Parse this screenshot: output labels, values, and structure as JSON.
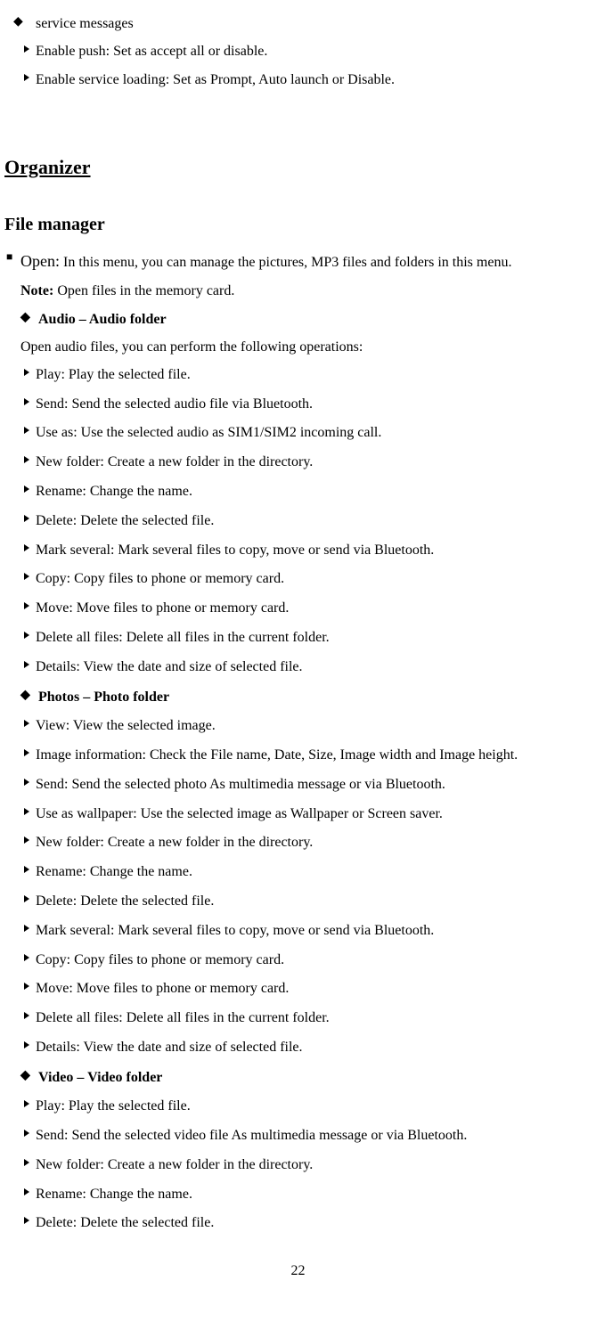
{
  "top": {
    "service_messages": "service messages",
    "enable_push": "Enable push: Set as accept all or disable.",
    "enable_service_loading": "Enable service loading: Set as Prompt, Auto launch or Disable."
  },
  "organizer_title": "Organizer",
  "file_manager_title": "File manager",
  "open": {
    "label": "Open:",
    "desc": " In this menu, you can manage the pictures, MP3 files and folders in this menu."
  },
  "note": {
    "label": "Note:",
    "desc": " Open files in the memory card."
  },
  "audio": {
    "title": "Audio – Audio folder",
    "intro": "Open audio files, you can perform the following operations:",
    "items": [
      "Play: Play the selected file.",
      "Send: Send the selected audio file via Bluetooth.",
      "Use as: Use the selected audio as SIM1/SIM2 incoming call.",
      "New folder: Create a new folder in the directory.",
      "Rename: Change the name.",
      "Delete: Delete the selected file.",
      "Mark several: Mark several files to copy, move or send via Bluetooth.",
      "Copy: Copy files to phone or memory card.",
      "Move: Move files to phone or memory card.",
      "Delete all files: Delete all files in the current folder.",
      "Details: View the date and size of selected file."
    ]
  },
  "photos": {
    "title": "Photos – Photo folder",
    "items": [
      "View: View the selected image.",
      "Image information: Check the File name, Date, Size, Image width and Image height.",
      "Send: Send the selected photo As multimedia message or via Bluetooth.",
      "Use as wallpaper: Use the selected image as Wallpaper or Screen saver.",
      "New folder: Create a new folder in the directory.",
      "Rename: Change the name.",
      "Delete: Delete the selected file.",
      "Mark several: Mark several files to copy, move or send via Bluetooth.",
      "Copy: Copy files to phone or memory card.",
      "Move: Move files to phone or memory card.",
      "Delete all files: Delete all files in the current folder.",
      "Details: View the date and size of selected file."
    ]
  },
  "video": {
    "title": "Video – Video folder",
    "items": [
      "Play: Play the selected file.",
      "Send: Send the selected video file As multimedia message or via Bluetooth.",
      "New folder: Create a new folder in the directory.",
      "Rename: Change the name.",
      "Delete: Delete the selected file."
    ]
  },
  "page_number": "22"
}
